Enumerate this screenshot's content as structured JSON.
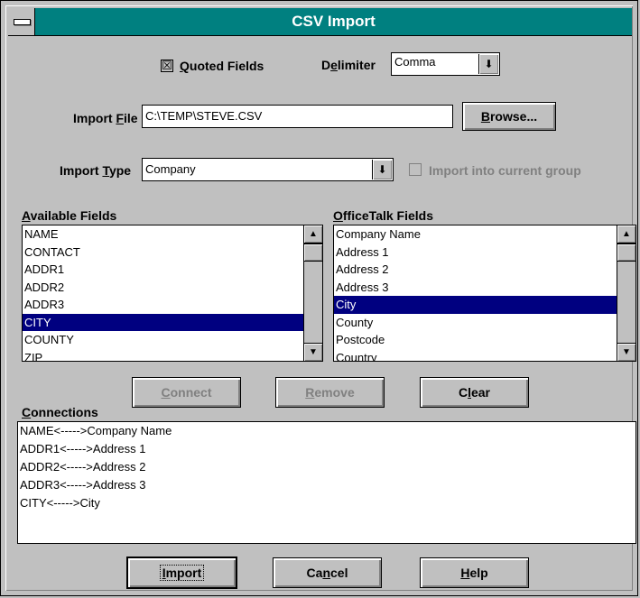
{
  "window": {
    "title": "CSV Import"
  },
  "options": {
    "quoted_fields": {
      "checked_mark": "☒",
      "prefix": "",
      "underline": "Q",
      "suffix": "uoted Fields"
    },
    "delimiter": {
      "prefix": "D",
      "underline": "e",
      "suffix": "limiter",
      "value": "Comma"
    }
  },
  "import_file": {
    "prefix": "Import ",
    "underline": "F",
    "suffix": "ile",
    "value": "C:\\TEMP\\STEVE.CSV",
    "browse": {
      "prefix": "",
      "underline": "B",
      "suffix": "rowse..."
    }
  },
  "import_type": {
    "prefix": "Import ",
    "underline": "T",
    "suffix": "ype",
    "value": "Company",
    "current_group": {
      "label": "Import into current group"
    }
  },
  "available_fields": {
    "heading": {
      "prefix": "",
      "underline": "A",
      "suffix": "vailable Fields"
    },
    "items": [
      "NAME",
      "CONTACT",
      "ADDR1",
      "ADDR2",
      "ADDR3",
      "CITY",
      "COUNTY",
      "ZIP"
    ],
    "selected_index": 5
  },
  "officetalk_fields": {
    "heading": {
      "prefix": "",
      "underline": "O",
      "suffix": "fficeTalk Fields"
    },
    "items": [
      "Company Name",
      "Address 1",
      "Address 2",
      "Address 3",
      "City",
      "County",
      "Postcode",
      "Country"
    ],
    "selected_index": 4
  },
  "actions": {
    "connect": {
      "prefix": "",
      "underline": "C",
      "suffix": "onnect"
    },
    "remove": {
      "prefix": "",
      "underline": "R",
      "suffix": "emove"
    },
    "clear": {
      "prefix": "C",
      "underline": "l",
      "suffix": "ear"
    }
  },
  "connections": {
    "heading": {
      "prefix": "",
      "underline": "C",
      "suffix": "onnections"
    },
    "items": [
      "NAME<----->Company Name",
      "ADDR1<----->Address 1",
      "ADDR2<----->Address 2",
      "ADDR3<----->Address 3",
      "CITY<----->City"
    ]
  },
  "footer": {
    "import": {
      "prefix": "",
      "underline": "I",
      "suffix": "mport"
    },
    "cancel": {
      "prefix": "Ca",
      "underline": "n",
      "suffix": "cel"
    },
    "help": {
      "prefix": "",
      "underline": "H",
      "suffix": "elp"
    }
  },
  "icons": {
    "dropdown": "arrow-down-icon",
    "scroll_up": "arrow-up-icon",
    "scroll_down": "arrow-down-icon"
  },
  "colors": {
    "titlebar": "#008080",
    "selection": "#000080",
    "face": "#c0c0c0"
  }
}
